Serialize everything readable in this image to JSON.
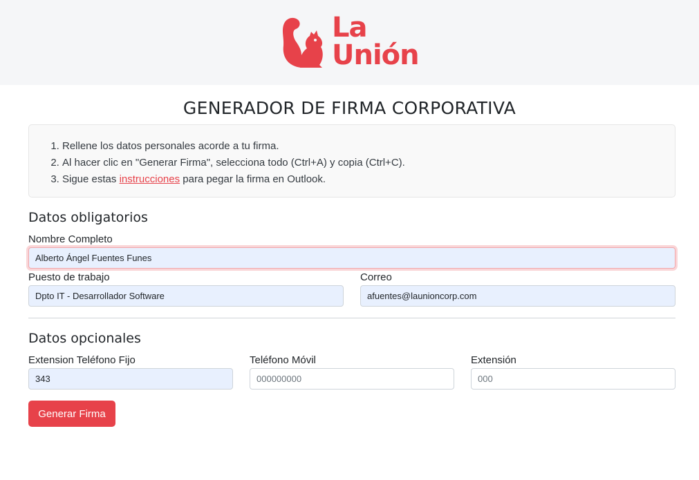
{
  "brand": {
    "logo_line1": "La",
    "logo_line2": "Unión",
    "accent_color": "#e7424a",
    "logo_icon": "squirrel-icon"
  },
  "page": {
    "title": "GENERADOR DE FIRMA CORPORATIVA"
  },
  "instructions": {
    "step1": "Rellene los datos personales acorde a tu firma.",
    "step2": "Al hacer clic en \"Generar Firma\", selecciona todo (Ctrl+A) y copia (Ctrl+C).",
    "step3_before": "Sigue estas ",
    "step3_link": "instrucciones",
    "step3_after": " para pegar la firma en Outlook."
  },
  "required": {
    "heading": "Datos obligatorios",
    "name_label": "Nombre Completo",
    "name_value": "Alberto Ángel Fuentes Funes",
    "job_label": "Puesto de trabajo",
    "job_value": "Dpto IT - Desarrollador Software",
    "email_label": "Correo",
    "email_value": "afuentes@launioncorp.com"
  },
  "optional": {
    "heading": "Datos opcionales",
    "landline_label": "Extension Teléfono Fijo",
    "landline_value": "343",
    "mobile_label": "Teléfono Móvil",
    "mobile_placeholder": "000000000",
    "ext_label": "Extensión",
    "ext_placeholder": "000"
  },
  "actions": {
    "generate_label": "Generar Firma"
  }
}
